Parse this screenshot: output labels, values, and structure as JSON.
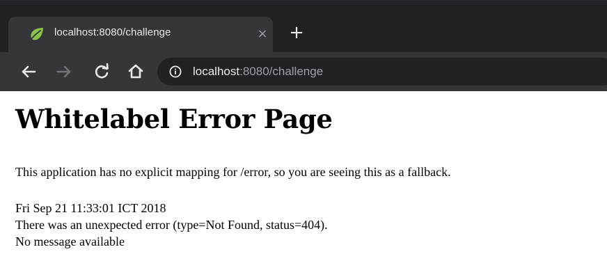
{
  "browser": {
    "tab": {
      "title": "localhost:8080/challenge",
      "close_glyph": "×",
      "favicon": "spring-leaf-icon"
    },
    "new_tab_glyph": "+",
    "address": {
      "host": "localhost",
      "rest": ":8080/challenge"
    },
    "colors": {
      "frame": "#202124",
      "toolbar": "#35363a",
      "text": "#e8eaed",
      "muted": "#9aa0a6",
      "favicon": "#8bc34a"
    }
  },
  "page": {
    "heading": "Whitelabel Error Page",
    "intro": "This application has no explicit mapping for /error, so you are seeing this as a fallback.",
    "timestamp": "Fri Sep 21 11:33:01 ICT 2018",
    "error_line": "There was an unexpected error (type=Not Found, status=404).",
    "message": "No message available"
  }
}
